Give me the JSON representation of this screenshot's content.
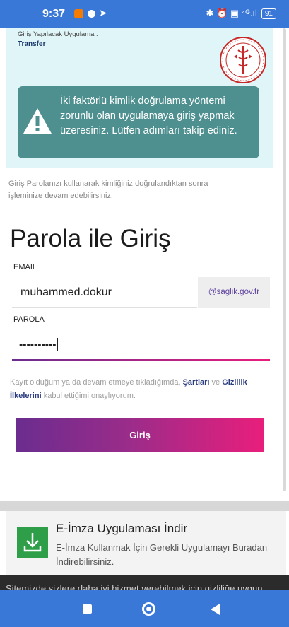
{
  "status_bar": {
    "time": "9:37",
    "right_icons": "✱ ⏰ ▣ ⁴ᴳ.ıl",
    "battery": "91"
  },
  "app_card": {
    "label": "Giriş Yapılacak Uygulama :",
    "name": "Transfer",
    "alert_text": "İki faktörlü kimlik doğrulama yöntemi zorunlu olan uygulamaya giriş yapmak üzeresiniz. Lütfen adımları takip ediniz."
  },
  "info_text": "Giriş Parolanızı kullanarak kimliğiniz doğrulandıktan sonra işleminize devam edebilirsiniz.",
  "form": {
    "title": "Parola ile Giriş",
    "email_label": "EMAIL",
    "email_value": "muhammed.dokur",
    "email_domain": "@saglik.gov.tr",
    "password_label": "PAROLA",
    "password_value": "••••••••••"
  },
  "terms": {
    "prefix": "Kayıt olduğum ya da devam etmeye tıkladığımda, ",
    "link1": "Şartları",
    "middle": " ve ",
    "link2": "Gizlilik İlkelerini",
    "suffix": " kabul ettiğimi onaylıyorum."
  },
  "login_button": "Giriş",
  "esign": {
    "title": "E-İmza Uygulaması İndir",
    "subtitle": "E-İmza Kullanmak İçin Gerekli Uygulamayı Buradan İndirebilirsiniz."
  },
  "cookie_text": "Sitemizde sizlere daha iyi hizmet verebilmek için gizliliğe uygun",
  "colors": {
    "accent_start": "#6a2d8f",
    "accent_end": "#e91e7c",
    "alert_bg": "#4e8f8f",
    "nav_blue": "#3a78d8"
  },
  "icons": [
    "warning-icon",
    "ministry-seal-icon",
    "download-icon",
    "home-icon",
    "back-icon",
    "recents-icon"
  ]
}
